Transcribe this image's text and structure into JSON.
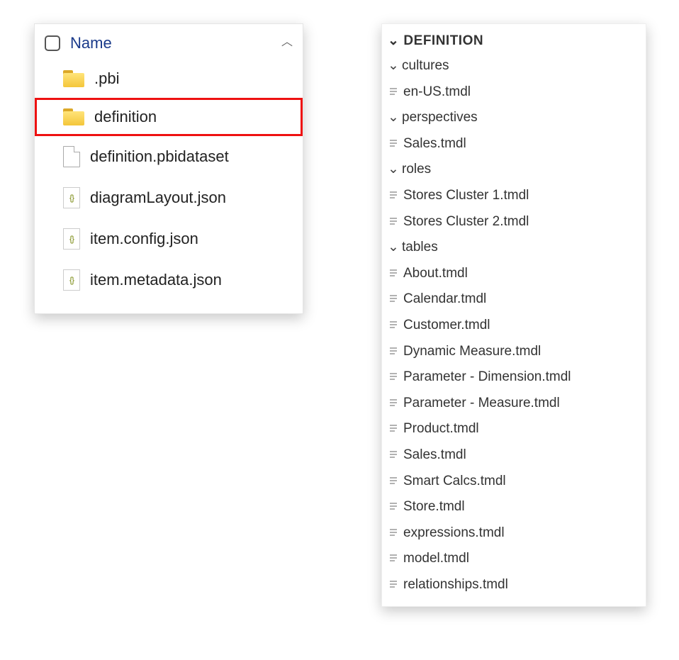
{
  "explorer": {
    "column_name": "Name",
    "items": [
      {
        "name": ".pbi",
        "type": "folder",
        "highlight": false
      },
      {
        "name": "definition",
        "type": "folder",
        "highlight": true
      },
      {
        "name": "definition.pbidataset",
        "type": "file",
        "highlight": false
      },
      {
        "name": "diagramLayout.json",
        "type": "json",
        "highlight": false
      },
      {
        "name": "item.config.json",
        "type": "json",
        "highlight": false
      },
      {
        "name": "item.metadata.json",
        "type": "json",
        "highlight": false
      }
    ]
  },
  "vscode": {
    "root": "DEFINITION",
    "folders": [
      {
        "name": "cultures",
        "files": [
          "en-US.tmdl"
        ]
      },
      {
        "name": "perspectives",
        "files": [
          "Sales.tmdl"
        ]
      },
      {
        "name": "roles",
        "files": [
          "Stores Cluster 1.tmdl",
          "Stores Cluster 2.tmdl"
        ]
      },
      {
        "name": "tables",
        "files": [
          "About.tmdl",
          "Calendar.tmdl",
          "Customer.tmdl",
          "Dynamic Measure.tmdl",
          "Parameter - Dimension.tmdl",
          "Parameter - Measure.tmdl",
          "Product.tmdl",
          "Sales.tmdl",
          "Smart Calcs.tmdl",
          "Store.tmdl"
        ]
      }
    ],
    "root_files": [
      "expressions.tmdl",
      "model.tmdl",
      "relationships.tmdl"
    ]
  }
}
